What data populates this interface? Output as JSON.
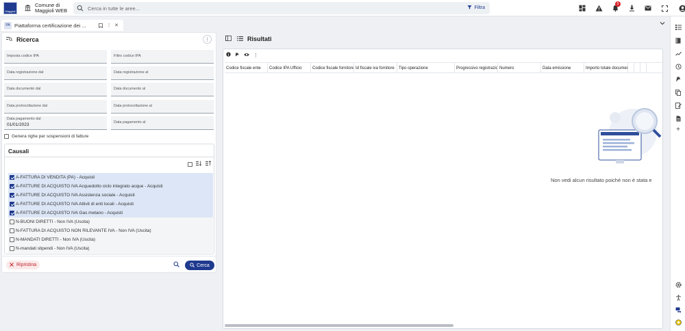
{
  "header": {
    "logo_text": "Maggioli",
    "app_line1": "Comune di",
    "app_line2": "Maggioli WEB",
    "search_placeholder": "Cerca in tutte le aree...",
    "filter_label": "Filtra",
    "notification_count": "5"
  },
  "tab": {
    "icon_text": "PA",
    "label": "Piattaforma certificazione dei ..."
  },
  "left_panel": {
    "title": "Ricerca",
    "fields": [
      {
        "label": "Imposta codice IPA",
        "value": ""
      },
      {
        "label": "Filtro codice IPA",
        "value": ""
      },
      {
        "label": "Data registrazione dal",
        "value": ""
      },
      {
        "label": "Data registrazione al",
        "value": ""
      },
      {
        "label": "Data documento dal",
        "value": ""
      },
      {
        "label": "Data documento al",
        "value": ""
      },
      {
        "label": "Data protocollazione dal",
        "value": ""
      },
      {
        "label": "Data protocollazione al",
        "value": ""
      },
      {
        "label": "Data pagamento dal",
        "value": "01/01/2023"
      },
      {
        "label": "Data pagamento al",
        "value": ""
      }
    ],
    "genera_label": "Genera righe per sospensioni di fatture",
    "causali_title": "Causali",
    "causali": [
      {
        "label": "A-FATTURA DI VENDITA (PA) - Acquisti",
        "checked": true
      },
      {
        "label": "A-FATTURE DI ACQUISTO IVA Acquedotto ciclo integrato acque - Acquisti",
        "checked": true
      },
      {
        "label": "A-FATTURE DI ACQUISTO IVA Assistenza sociale - Acquisti",
        "checked": true
      },
      {
        "label": "A-FATTURE DI ACQUISTO IVA Attivit di enti locali - Acquisti",
        "checked": true
      },
      {
        "label": "A-FATTURE DI ACQUISTO IVA Gas metano - Acquisti",
        "checked": true
      },
      {
        "label": "N-BUONI DIRETTI - Non IVA (Uscita)",
        "checked": false
      },
      {
        "label": "N-FATTURA DI ACQUISTO NON RILEVANTE IVA - Non IVA (Uscita)",
        "checked": false
      },
      {
        "label": "N-MANDATI DIRETTI - Non IVA (Uscita)",
        "checked": false
      },
      {
        "label": "N-mandati stipendi - Non IVA (Uscita)",
        "checked": false
      }
    ],
    "reset_label": "Ripristina",
    "search_label": "Cerca"
  },
  "right_panel": {
    "title": "Risultati",
    "columns": [
      "Codice fiscale ente",
      "Codice IPA Ufficio",
      "Codice fiscale fornitore",
      "Id fiscale iva fornitore",
      "Tipo operazione",
      "Progressivo registrazione",
      "Numero",
      "Data emissione",
      "Importo totale documento",
      "",
      "",
      ""
    ],
    "empty_message": "Non vedi alcun risultato poiché non è stata e"
  },
  "colors": {
    "brand": "#1f3a8f",
    "danger": "#c0282e",
    "selected_row": "#dce6f6"
  }
}
